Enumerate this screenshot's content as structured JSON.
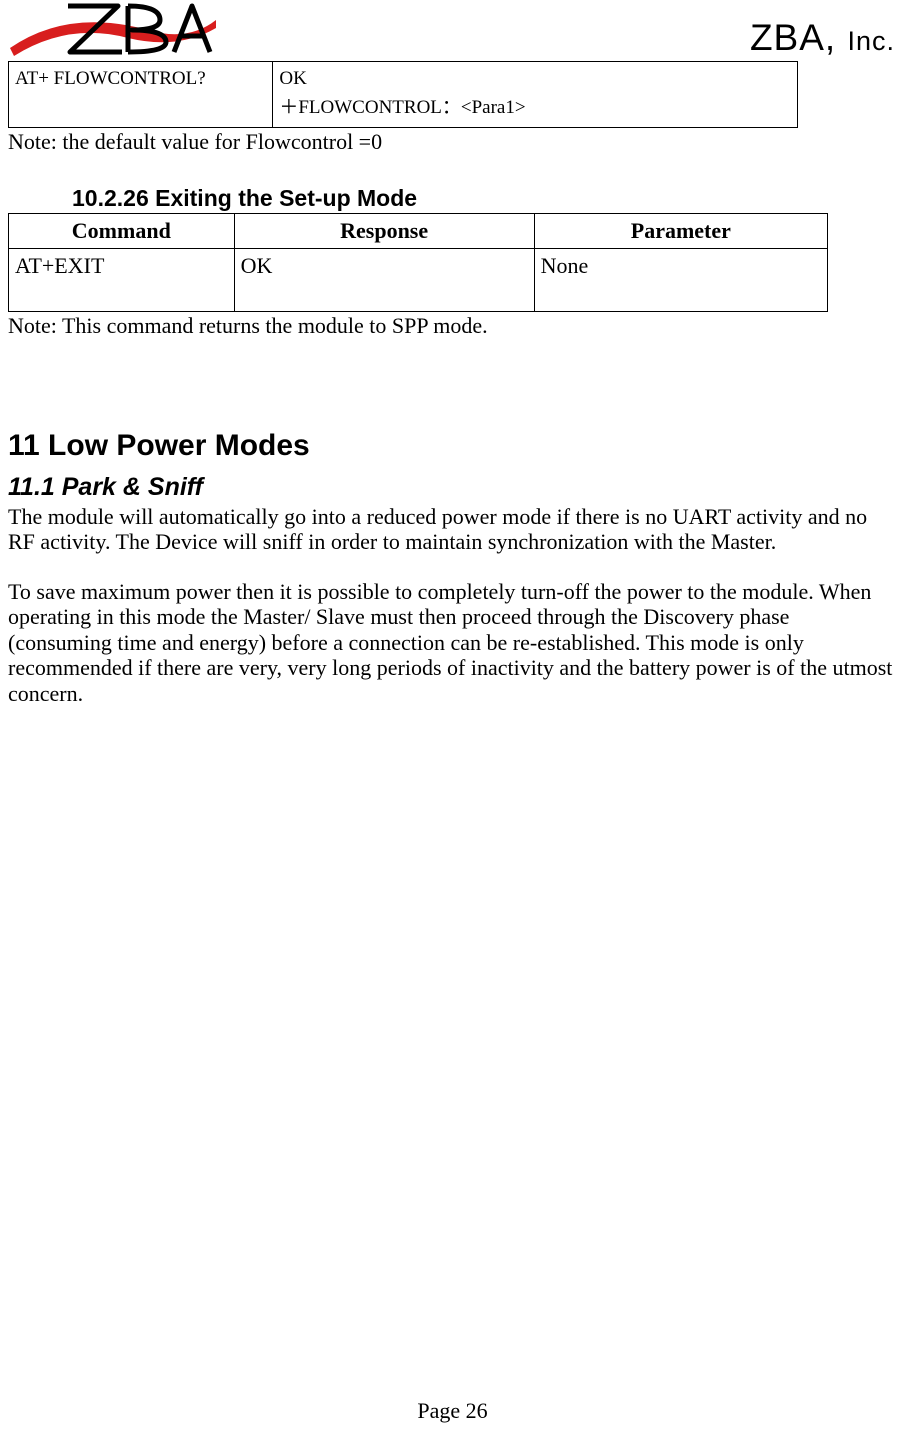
{
  "header": {
    "company_main": "ZBA, ",
    "company_sub": "Inc."
  },
  "table1": {
    "row1_col1": "AT+ FLOWCONTROL?",
    "row1_col2_l1": "OK",
    "row1_col2_l2": "＋FLOWCONTROL：<Para1>"
  },
  "note1": "Note: the default value for Flowcontrol =0",
  "section_10_2_26": {
    "title": "10.2.26 Exiting the Set-up Mode",
    "headers": {
      "c1": "Command",
      "c2": "Response",
      "c3": "Parameter"
    },
    "row": {
      "c1": "AT+EXIT",
      "c2": "OK",
      "c3": "None"
    },
    "note": "Note: This command returns the module to SPP mode."
  },
  "section_11": {
    "title": "11 Low Power Modes",
    "sub_title": "11.1 Park & Sniff",
    "p1": "The module will automatically go into a reduced power mode if there is no UART activity and no RF activity. The Device will sniff in order to maintain synchronization with the Master.",
    "p2": "To save maximum power then it is possible to completely turn-off the power to the module. When operating in this mode the Master/ Slave must then proceed through the Discovery phase (consuming time and energy) before a connection can be re-established. This mode is only recommended if there are very, very long periods of inactivity and the battery power is of the utmost concern."
  },
  "footer": "Page 26"
}
